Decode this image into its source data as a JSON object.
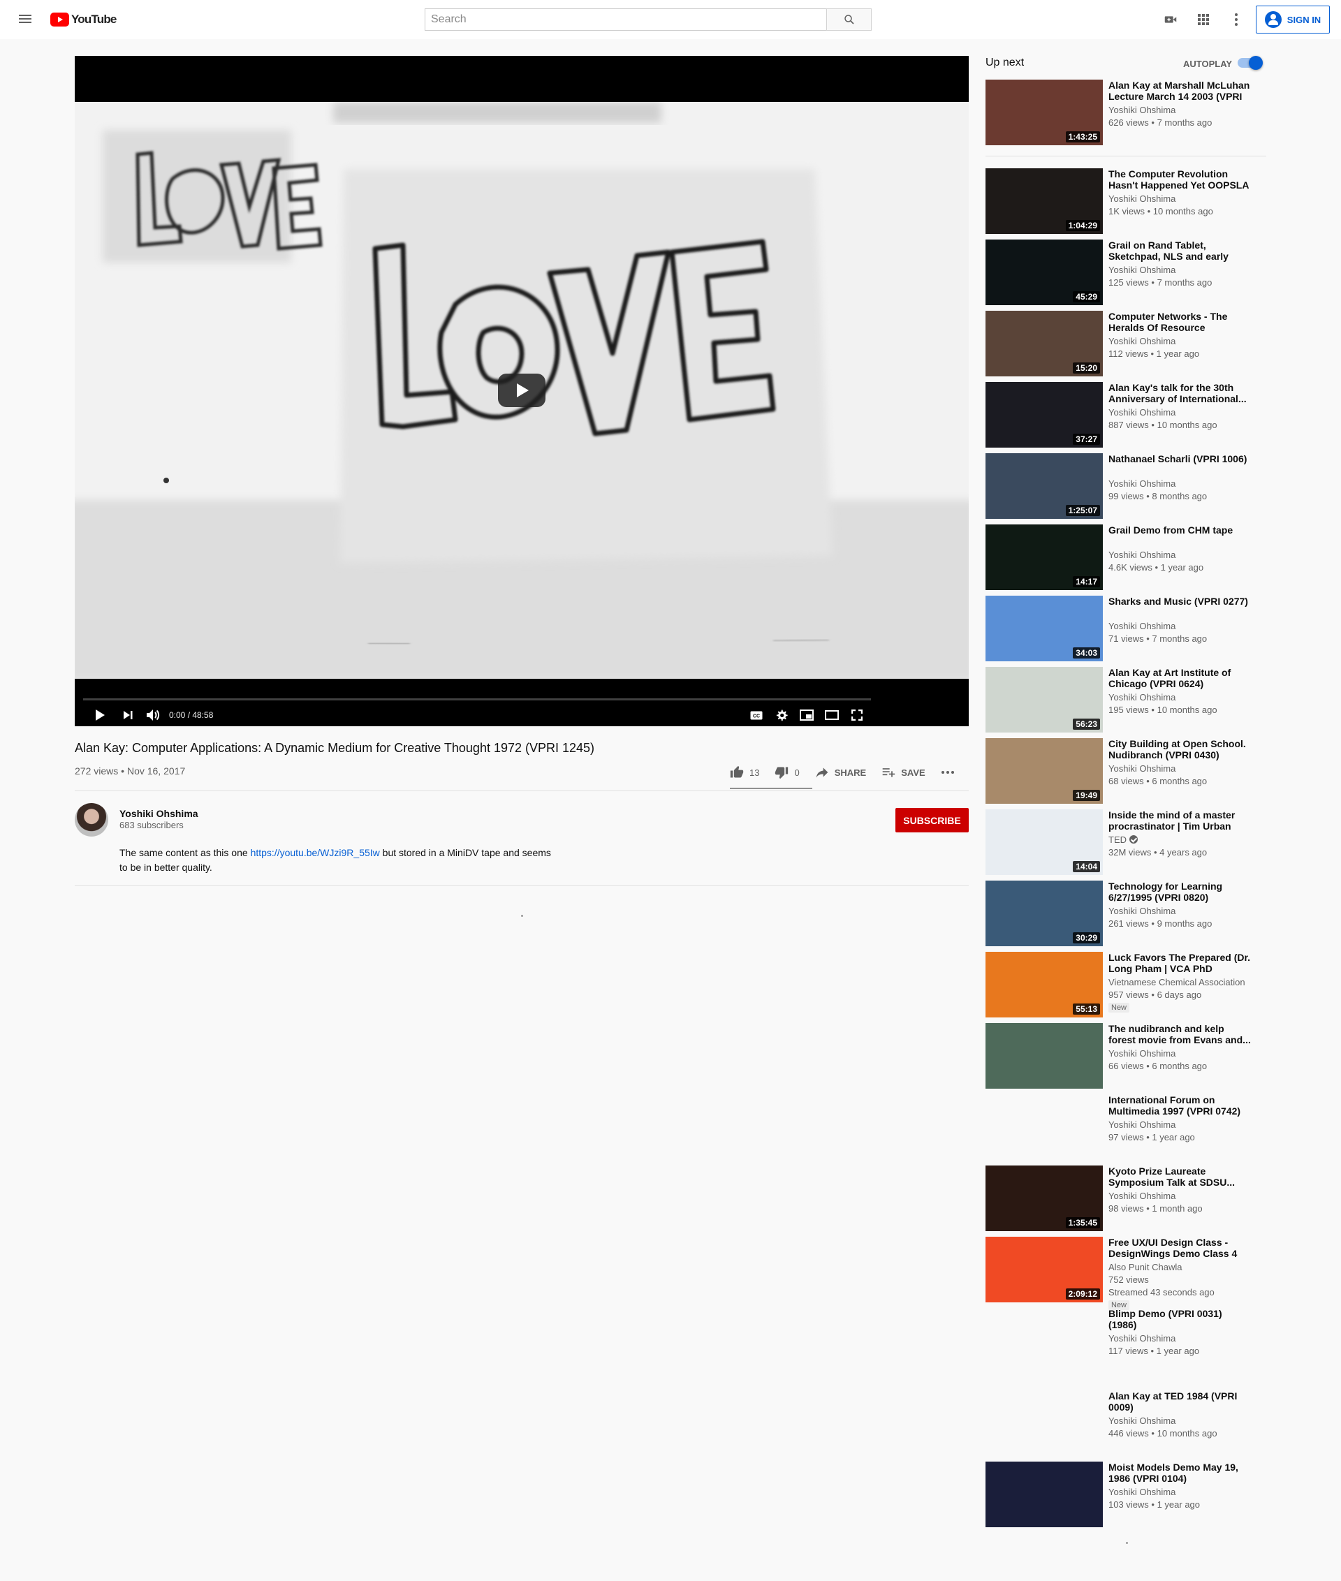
{
  "header": {
    "logo_text": "YouTube",
    "search_placeholder": "Search",
    "signin_label": "SIGN IN",
    "icons": [
      "menu-icon",
      "search-icon",
      "create-video-icon",
      "apps-icon",
      "more-vert-icon",
      "account-icon"
    ]
  },
  "player": {
    "time_current": "0:00",
    "time_total": "48:58",
    "progress": 0.0,
    "icons": [
      "play-icon",
      "next-icon",
      "volume-icon",
      "captions-icon",
      "settings-icon",
      "miniplayer-icon",
      "theater-icon",
      "fullscreen-icon"
    ]
  },
  "video": {
    "title": "Alan Kay: Computer Applications: A Dynamic Medium for Creative Thought 1972 (VPRI 1245)",
    "views": "272 views",
    "date": "Nov 16, 2017",
    "likes": "13",
    "dislikes": "0",
    "share_label": "SHARE",
    "save_label": "SAVE"
  },
  "owner": {
    "name": "Yoshiki Ohshima",
    "subscribers": "683 subscribers",
    "subscribe_label": "SUBSCRIBE"
  },
  "description": {
    "before_link": "The same content as this one ",
    "link": "https://youtu.be/WJzi9R_55Iw",
    "after_link": " but stored in a MiniDV tape and seems to be in better quality."
  },
  "sidebar": {
    "up_next_label": "Up next",
    "autoplay_label": "AUTOPLAY",
    "autoplay_on": true,
    "videos": [
      {
        "title": "Alan Kay at Marshall McLuhan Lecture March 14 2003 (VPRI 0...",
        "channel": "Yoshiki Ohshima",
        "meta": "626 views • 7 months ago",
        "duration": "1:43:25",
        "thumb_color": "#6b3a30"
      },
      {
        "title": "The Computer Revolution Hasn't Happened Yet OOPSLA 1997...",
        "channel": "Yoshiki Ohshima",
        "meta": "1K views • 10 months ago",
        "duration": "1:04:29",
        "thumb_color": "#1e1a18"
      },
      {
        "title": "Grail on Rand Tablet, Sketchpad, NLS and early GUI...",
        "channel": "Yoshiki Ohshima",
        "meta": "125 views • 7 months ago",
        "duration": "45:29",
        "thumb_color": "#0d1416"
      },
      {
        "title": "Computer Networks - The Heralds Of Resource Sharing...",
        "channel": "Yoshiki Ohshima",
        "meta": "112 views • 1 year ago",
        "duration": "15:20",
        "thumb_color": "#5a4438"
      },
      {
        "title": "Alan Kay's talk for the 30th Anniversary of International...",
        "channel": "Yoshiki Ohshima",
        "meta": "887 views • 10 months ago",
        "duration": "37:27",
        "thumb_color": "#1b1b22"
      },
      {
        "title": "Nathanael Scharli (VPRI 1006)",
        "channel": "Yoshiki Ohshima",
        "meta": "99 views • 8 months ago",
        "duration": "1:25:07",
        "thumb_color": "#3a4a5e"
      },
      {
        "title": "Grail Demo from CHM tape",
        "channel": "Yoshiki Ohshima",
        "meta": "4.6K views • 1 year ago",
        "duration": "14:17",
        "thumb_color": "#0f1a14"
      },
      {
        "title": "Sharks and Music (VPRI 0277)",
        "channel": "Yoshiki Ohshima",
        "meta": "71 views • 7 months ago",
        "duration": "34:03",
        "thumb_color": "#5a8fd6"
      },
      {
        "title": "Alan Kay at Art Institute of Chicago (VPRI 0624)",
        "channel": "Yoshiki Ohshima",
        "meta": "195 views • 10 months ago",
        "duration": "56:23",
        "thumb_color": "#cfd6cf"
      },
      {
        "title": "City Building at Open School. Nudibranch (VPRI 0430)",
        "channel": "Yoshiki Ohshima",
        "meta": "68 views • 6 months ago",
        "duration": "19:49",
        "thumb_color": "#a88a6a"
      },
      {
        "title": "Inside the mind of a master procrastinator | Tim Urban",
        "channel": "TED",
        "verified": true,
        "meta": "32M views • 4 years ago",
        "duration": "14:04",
        "thumb_color": "#e8edf2"
      },
      {
        "title": "Technology for Learning 6/27/1995 (VPRI 0820)",
        "channel": "Yoshiki Ohshima",
        "meta": "261 views • 9 months ago",
        "duration": "30:29",
        "thumb_color": "#3a5a78"
      },
      {
        "title": "Luck Favors The Prepared (Dr. Long Pham | VCA PhD Webinar...",
        "channel": "Vietnamese Chemical Association",
        "meta": "957 views • 6 days ago",
        "badge": "New",
        "duration": "55:13",
        "thumb_color": "#e8781e"
      },
      {
        "title": "The nudibranch and kelp forest movie from Evans and...",
        "channel": "Yoshiki Ohshima",
        "meta": "66 views • 6 months ago",
        "duration": "",
        "thumb_color": "#4e6a5a"
      },
      {
        "title": "International Forum on Multimedia 1997 (VPRI 0742)",
        "channel": "Yoshiki Ohshima",
        "meta": "97 views • 1 year ago",
        "duration": "",
        "thumb_color": ""
      },
      {
        "title": "Kyoto Prize Laureate Symposium Talk at SDSU...",
        "channel": "Yoshiki Ohshima",
        "meta": "98 views • 1 month ago",
        "duration": "1:35:45",
        "thumb_color": "#2a1812"
      },
      {
        "title": "Free UX/UI Design Class - DesignWings Demo Class 4",
        "channel": "Also Punit Chawla",
        "meta": "752 views",
        "extra": "Streamed 43 seconds ago",
        "badge": "New",
        "duration": "2:09:12",
        "thumb_color": "#f04a24"
      },
      {
        "title": "Blimp Demo (VPRI 0031) (1986)",
        "channel": "Yoshiki Ohshima",
        "meta": "117 views • 1 year ago",
        "duration": "",
        "thumb_color": ""
      },
      {
        "title": "Alan Kay at TED 1984 (VPRI 0009)",
        "channel": "Yoshiki Ohshima",
        "meta": "446 views • 10 months ago",
        "duration": "",
        "thumb_color": ""
      },
      {
        "title": "Moist Models Demo May 19, 1986 (VPRI 0104)",
        "channel": "Yoshiki Ohshima",
        "meta": "103 views • 1 year ago",
        "duration": "",
        "thumb_color": "#1a1e3a"
      }
    ]
  }
}
